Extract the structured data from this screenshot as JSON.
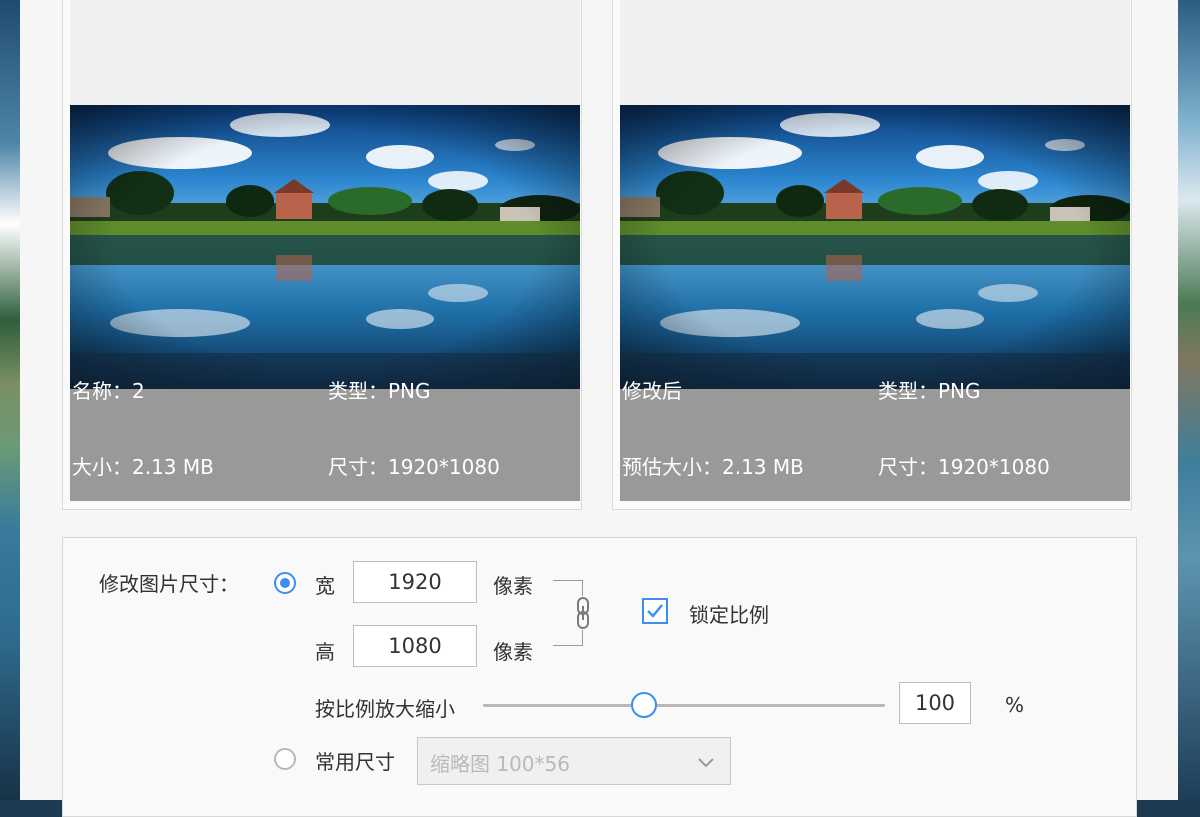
{
  "preview_original": {
    "name": "名称：2",
    "type": "类型：PNG",
    "size": "大小：2.13 MB",
    "dimensions": "尺寸：1920*1080"
  },
  "preview_modified": {
    "name": "修改后",
    "type": "类型：PNG",
    "size": "预估大小：2.13 MB",
    "dimensions": "尺寸：1920*1080"
  },
  "resize": {
    "section_label": "修改图片尺寸：",
    "width_label": "宽",
    "width_value": "1920",
    "width_unit": "像素",
    "height_label": "高",
    "height_value": "1080",
    "height_unit": "像素",
    "lock_ratio_label": "锁定比例",
    "lock_ratio_checked": true,
    "scale_label": "按比例放大缩小",
    "scale_value": "100",
    "scale_unit": "%",
    "scale_fraction": 0.4,
    "preset_label": "常用尺寸",
    "preset_selected": "缩略图 100*56"
  },
  "colors": {
    "accent": "#3c8ef0",
    "info_gray": "#999999"
  },
  "icons": {
    "link": "chain-link-icon",
    "dropdown": "chevron-down-icon",
    "check": "checkmark-icon"
  }
}
